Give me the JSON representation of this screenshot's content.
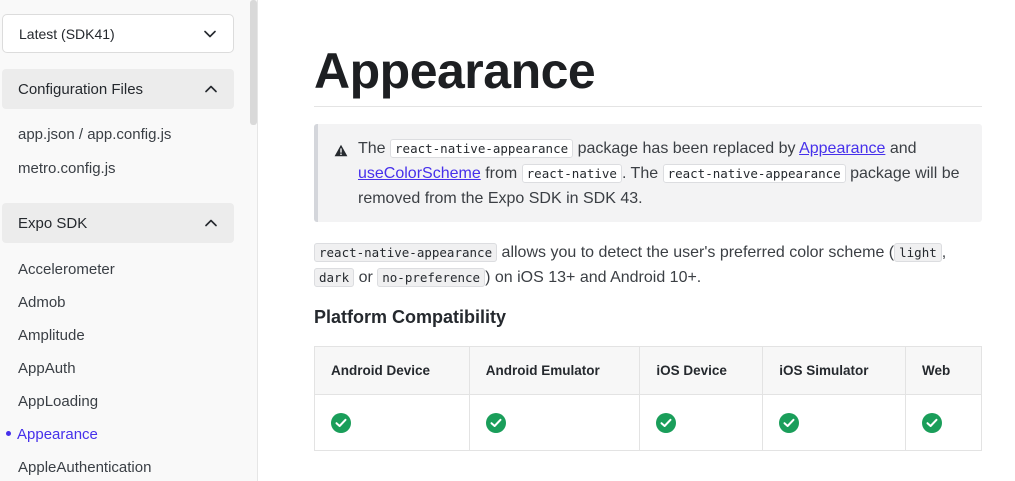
{
  "sidebar": {
    "version_select": "Latest (SDK41)",
    "sections": [
      {
        "label": "Configuration Files",
        "items": [
          "app.json / app.config.js",
          "metro.config.js"
        ]
      },
      {
        "label": "Expo SDK",
        "items": [
          "Accelerometer",
          "Admob",
          "Amplitude",
          "AppAuth",
          "AppLoading",
          "Appearance",
          "AppleAuthentication"
        ]
      }
    ],
    "active_item": "Appearance"
  },
  "main": {
    "title": "Appearance",
    "callout": {
      "t1": "The",
      "code1": "react-native-appearance",
      "t2": "package has been replaced by",
      "link1": "Appearance",
      "t3": "and",
      "link2": "useColorScheme",
      "t4": "from",
      "code2": "react-native",
      "t5": ". The",
      "code3": "react-native-appearance",
      "t6": "package will be removed from the Expo SDK in SDK 43."
    },
    "intro": {
      "code1": "react-native-appearance",
      "t1": "allows you to detect the user's preferred color scheme (",
      "code2": "light",
      "t2": ",",
      "code3": "dark",
      "t3": "or",
      "code4": "no-preference",
      "t4": ") on iOS 13+ and Android 10+."
    },
    "compat_heading": "Platform Compatibility",
    "compat_table": {
      "headers": [
        "Android Device",
        "Android Emulator",
        "iOS Device",
        "iOS Simulator",
        "Web"
      ],
      "supported": [
        true,
        true,
        true,
        true,
        true
      ]
    }
  },
  "colors": {
    "accent": "#4630eb",
    "check_green": "#1a9e5a"
  },
  "icons": [
    "chevron-down-icon",
    "chevron-up-icon",
    "warning-icon",
    "check-circle-icon"
  ]
}
